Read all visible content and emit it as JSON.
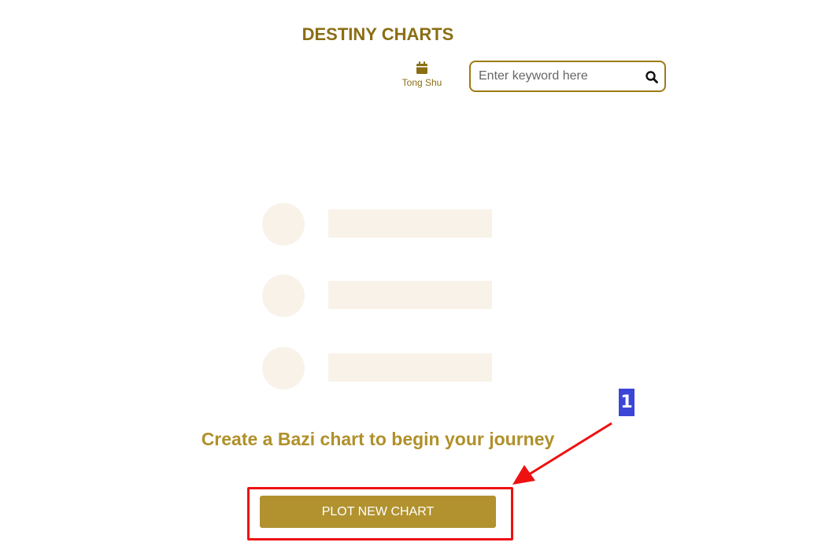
{
  "header": {
    "title": "DESTINY CHARTS",
    "tongshu_label": "Tong Shu",
    "tongshu_icon": "calendar-icon",
    "search_placeholder": "Enter keyword here",
    "search_value": "",
    "search_icon": "search-icon"
  },
  "main": {
    "cta_text": "Create a Bazi chart to begin your journey",
    "plot_button_label": "PLOT NEW CHART"
  },
  "annotation": {
    "marker_label": "1",
    "highlight_color": "#ee1111",
    "marker_color": "#3c46d6"
  },
  "colors": {
    "brand_gold": "#8b6d14",
    "button_gold": "#b1922f",
    "placeholder_fill": "#f8f2e9"
  }
}
